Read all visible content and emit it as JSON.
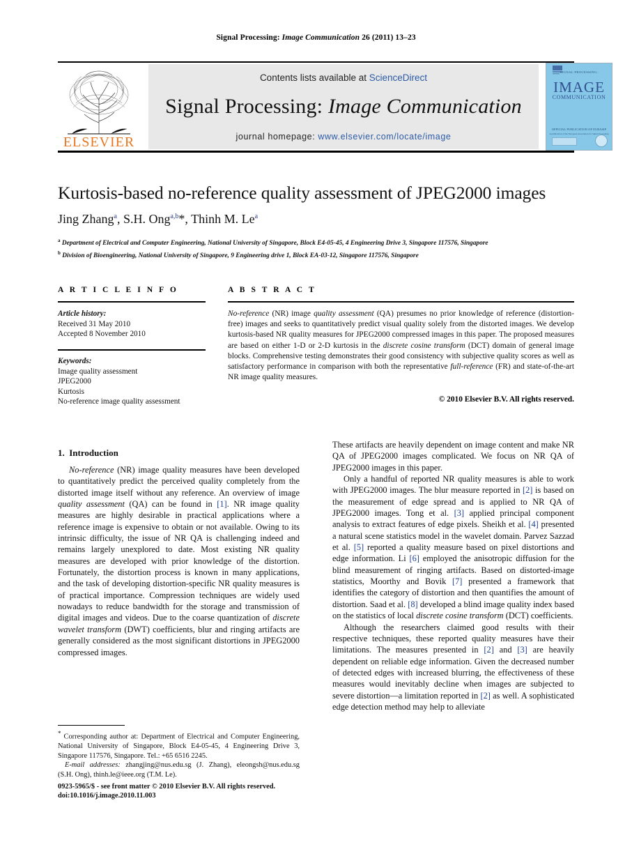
{
  "running_head": {
    "journal_plain": "Signal Processing:",
    "journal_italic": "Image Communication",
    "citation": "26 (2011) 13–23"
  },
  "masthead": {
    "contents_prefix": "Contents lists available at ",
    "sciencedirect": "ScienceDirect",
    "journal_title_plain": "Signal Processing:",
    "journal_title_italic": "Image Communication",
    "homepage_prefix": "journal homepage: ",
    "homepage_url": "www.elsevier.com/locate/image",
    "publisher": "ELSEVIER",
    "cover": {
      "top_label": "SIGNAL PROCESSING:",
      "big": "IMAGE",
      "sub": "COMMUNICATION",
      "mid_label": "OFFICIAL PUBLICATION OF EURASIP",
      "mid_label2": "A publication of the European Association for Signal Processing"
    },
    "link_color": "#2b5aa7",
    "panel_color": "#e8e8e8"
  },
  "article": {
    "title": "Kurtosis-based no-reference quality assessment of JPEG2000 images",
    "authors": [
      {
        "name": "Jing Zhang",
        "sup": "a"
      },
      {
        "name": "S.H. Ong",
        "sup": "a,b",
        "corresponding": "*"
      },
      {
        "name": "Thinh M. Le",
        "sup": "a"
      }
    ],
    "affiliations": [
      {
        "mark": "a",
        "text": "Department of Electrical and Computer Engineering, National University of Singapore, Block E4-05-45, 4 Engineering Drive 3, Singapore 117576, Singapore"
      },
      {
        "mark": "b",
        "text": "Division of Bioengineering, National University of Singapore, 9 Engineering drive 1, Block EA-03-12, Singapore 117576, Singapore"
      }
    ]
  },
  "article_info": {
    "heading": "A R T I C L E  I N F O",
    "history_label": "Article history:",
    "received": "Received 31 May 2010",
    "accepted": "Accepted 8 November 2010",
    "keywords_label": "Keywords:",
    "keywords": [
      "Image quality assessment",
      "JPEG2000",
      "Kurtosis",
      "No-reference image quality assessment"
    ]
  },
  "abstract": {
    "heading": "A B S T R A C T",
    "parts": [
      {
        "t": "No-reference",
        "i": true
      },
      {
        "t": " (NR) image ",
        "i": false
      },
      {
        "t": "quality assessment",
        "i": true
      },
      {
        "t": " (QA) presumes no prior knowledge of reference (distortion-free) images and seeks to quantitatively predict visual quality solely from the distorted images. We develop kurtosis-based NR quality measures for JPEG2000 compressed images in this paper. The proposed measures are based on either 1-D or 2-D kurtosis in the ",
        "i": false
      },
      {
        "t": "discrete cosine transform",
        "i": true
      },
      {
        "t": " (DCT) domain of general image blocks. Comprehensive testing demonstrates their good consistency with subjective quality scores as well as satisfactory performance in comparison with both the representative ",
        "i": false
      },
      {
        "t": "full-reference",
        "i": true
      },
      {
        "t": " (FR) and state-of-the-art NR image quality measures.",
        "i": false
      }
    ],
    "copyright": "© 2010 Elsevier B.V. All rights reserved."
  },
  "body": {
    "section_number": "1.",
    "section_title": "Introduction",
    "left_paragraphs": [
      [
        {
          "t": "No-reference",
          "i": true
        },
        {
          "t": " (NR) image quality measures have been developed to quantitatively predict the perceived quality completely from the distorted image itself without any reference. An overview of image ",
          "i": false
        },
        {
          "t": "quality assessment",
          "i": true
        },
        {
          "t": " (QA) can be found in ",
          "i": false
        },
        {
          "t": "[1]",
          "ref": true
        },
        {
          "t": ". NR image quality measures are highly desirable in practical applications where a reference image is expensive to obtain or not available. Owing to its intrinsic difficulty, the issue of NR QA is challenging indeed and remains largely unexplored to date. Most existing NR quality measures are developed with prior knowledge of the distortion. Fortunately, the distortion process is known in many applications, and the task of developing distortion-specific NR quality measures is of practical importance. Compression techniques are widely used nowadays to reduce bandwidth for the storage and transmission of digital images and videos. Due to the coarse quantization of ",
          "i": false
        },
        {
          "t": "discrete wavelet transform",
          "i": true
        },
        {
          "t": " (DWT) coefficients, blur and ringing artifacts are generally considered as the most significant distortions in JPEG2000 compressed images.",
          "i": false
        }
      ]
    ],
    "right_paragraphs": [
      [
        {
          "t": "These artifacts are heavily dependent on image content and make NR QA of JPEG2000 images complicated. We focus on NR QA of JPEG2000 images in this paper.",
          "i": false
        }
      ],
      [
        {
          "t": "Only a handful of reported NR quality measures is able to work with JPEG2000 images. The blur measure reported in ",
          "i": false
        },
        {
          "t": "[2]",
          "ref": true
        },
        {
          "t": " is based on the measurement of edge spread and is applied to NR QA of JPEG2000 images. Tong et al. ",
          "i": false
        },
        {
          "t": "[3]",
          "ref": true
        },
        {
          "t": " applied principal component analysis to extract features of edge pixels. Sheikh et al. ",
          "i": false
        },
        {
          "t": "[4]",
          "ref": true
        },
        {
          "t": " presented a natural scene statistics model in the wavelet domain. Parvez Sazzad et al. ",
          "i": false
        },
        {
          "t": "[5]",
          "ref": true
        },
        {
          "t": " reported a quality measure based on pixel distortions and edge information. Li ",
          "i": false
        },
        {
          "t": "[6]",
          "ref": true
        },
        {
          "t": " employed the anisotropic diffusion for the blind measurement of ringing artifacts. Based on distorted-image statistics, Moorthy and Bovik ",
          "i": false
        },
        {
          "t": "[7]",
          "ref": true
        },
        {
          "t": " presented a framework that identifies the category of distortion and then quantifies the amount of distortion. Saad et al. ",
          "i": false
        },
        {
          "t": "[8]",
          "ref": true
        },
        {
          "t": " developed a blind image quality index based on the statistics of local ",
          "i": false
        },
        {
          "t": "discrete cosine transform",
          "i": true
        },
        {
          "t": " (DCT) coefficients.",
          "i": false
        }
      ],
      [
        {
          "t": "Although the researchers claimed good results with their respective techniques, these reported quality measures have their limitations. The measures presented in ",
          "i": false
        },
        {
          "t": "[2]",
          "ref": true
        },
        {
          "t": " and ",
          "i": false
        },
        {
          "t": "[3]",
          "ref": true
        },
        {
          "t": " are heavily dependent on reliable edge information. Given the decreased number of detected edges with increased blurring, the effectiveness of these measures would inevitably decline when images are subjected to severe distortion—a limitation reported in ",
          "i": false
        },
        {
          "t": "[2]",
          "ref": true
        },
        {
          "t": " as well. A sophisticated edge detection method may help to alleviate",
          "i": false
        }
      ]
    ]
  },
  "footnote": {
    "star": "*",
    "corresponding": " Corresponding author at: Department of Electrical and Computer Engineering, National University of Singapore, Block E4-05-45, 4 Engineering Drive 3, Singapore 117576, Singapore. Tel.: +65 6516 2245.",
    "email_label": "E-mail addresses:",
    "emails": "zhangjing@nus.edu.sg (J. Zhang), eleongsh@nus.edu.sg (S.H. Ong), thinh.le@ieee.org (T.M. Le)."
  },
  "imprint": {
    "line1": "0923-5965/$ - see front matter © 2010 Elsevier B.V. All rights reserved.",
    "line2": "doi:10.1016/j.image.2010.11.003"
  }
}
